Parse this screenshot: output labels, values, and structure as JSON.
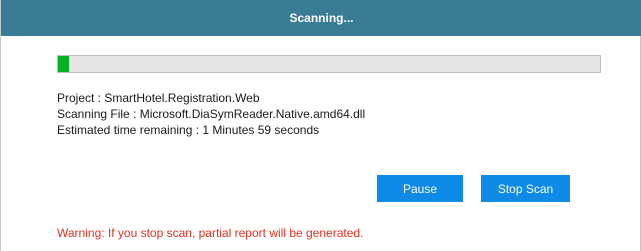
{
  "dialog": {
    "title": "Scanning..."
  },
  "progress": {
    "fraction": 0.02,
    "fill_color": "#06b025"
  },
  "info": {
    "project": "Project : SmartHotel.Registration.Web",
    "scanning_file": "Scanning File : Microsoft.DiaSymReader.Native.amd64.dll",
    "time_remaining": "Estimated time remaining : 1 Minutes 59 seconds"
  },
  "buttons": {
    "pause_label": "Pause",
    "stop_label": "Stop Scan"
  },
  "warning": "Warning: If you stop scan, partial report will be generated.",
  "colors": {
    "titlebar": "#3a7b96",
    "button": "#0f8ae6",
    "warning": "#e0301e"
  }
}
